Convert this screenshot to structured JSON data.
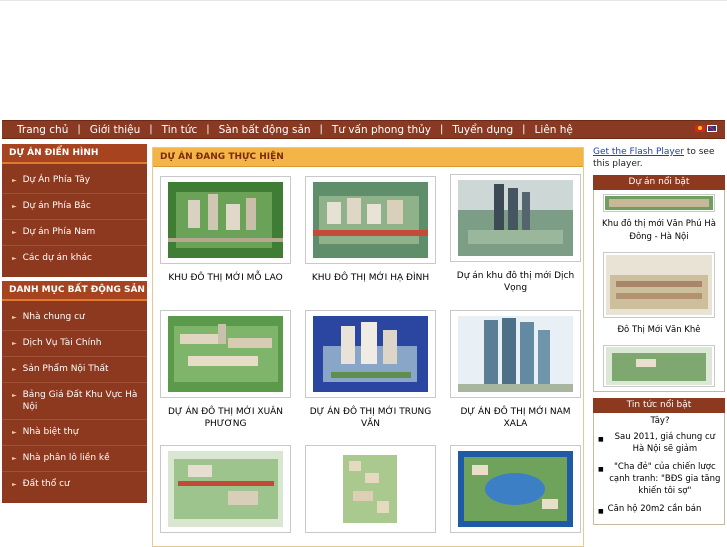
{
  "nav": {
    "items": [
      "Trang chủ",
      "Giới thiệu",
      "Tin tức",
      "Sàn bất động sản",
      "Tư vấn phong thủy",
      "Tuyển dụng",
      "Liên hệ"
    ],
    "separator": "|"
  },
  "left": {
    "section1": {
      "title": "DỰ ÁN ĐIỂN HÌNH",
      "items": [
        "Dự Án Phía Tây",
        "Dự án Phía Bắc",
        "Dự án Phía Nam",
        "Các dự án khác"
      ]
    },
    "section2": {
      "title": "DANH MỤC BẤT ĐỘNG SẢN",
      "items": [
        "Nhà chung cư",
        "Dịch Vụ Tài Chính",
        "Sản Phẩm Nội Thất",
        "Bảng Giá Đất Khu Vực Hà Nội",
        "Nhà biệt thự",
        "Nhà phân lô liền kề",
        "Đất thổ cư"
      ]
    }
  },
  "main": {
    "title": "DỰ ÁN ĐANG THỰC HIỆN",
    "projects": [
      {
        "caption": "KHU ĐÔ THỊ MỚI MỖ LAO"
      },
      {
        "caption": "KHU ĐÔ THỊ MỚI HẠ ĐÌNH"
      },
      {
        "caption": "Dự án khu đô thị mới Dịch Vọng"
      },
      {
        "caption": "DỰ ÁN ĐÔ THỊ MỚI XUÂN PHƯƠNG"
      },
      {
        "caption": "DỰ ÁN ĐÔ THỊ MỚI TRUNG VĂN"
      },
      {
        "caption": "DỰ ÁN ĐÔ THỊ MỚI NAM XALA"
      },
      {
        "caption": ""
      },
      {
        "caption": ""
      },
      {
        "caption": ""
      }
    ]
  },
  "right": {
    "flash": {
      "link": "Get the Flash Player",
      "text": " to see this player."
    },
    "featured": {
      "title": "Dự án nổi bật",
      "items": [
        "Khu đô thị mới Văn Phú Hà Đông - Hà Nội",
        "Đô Thị Mới Văn Khê"
      ]
    },
    "news": {
      "title": "Tin tức nổi bật",
      "top_fragment": "Tây?",
      "items": [
        "Sau 2011, giá chung cư Hà Nội sẽ giảm",
        "\"Cha đẻ\" của chiến lược cạnh tranh: \"BĐS gia tăng khiến tôi sợ\"",
        "Căn hộ 20m2 cần bán"
      ]
    }
  }
}
